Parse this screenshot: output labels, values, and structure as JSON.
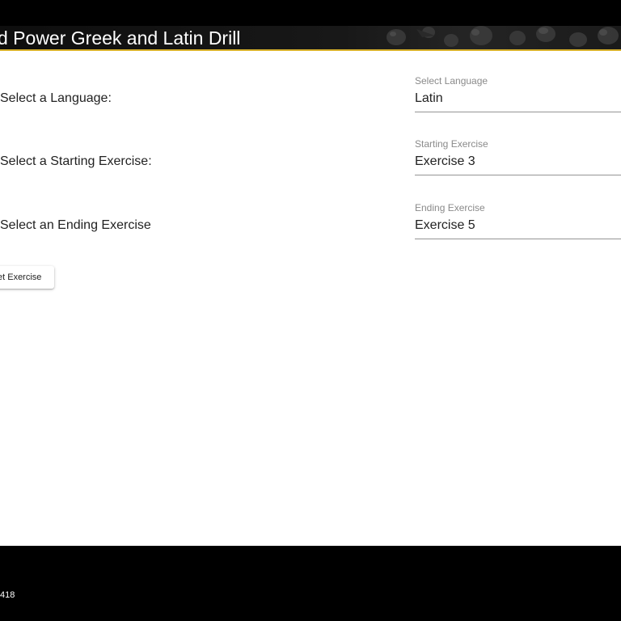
{
  "header": {
    "title": "d Power Greek and Latin Drill",
    "accent_color": "#d8b12b"
  },
  "form": {
    "rows": [
      {
        "label": "Select a Language:",
        "field_label": "Select Language",
        "value": "Latin"
      },
      {
        "label": "Select a Starting Exercise:",
        "field_label": "Starting Exercise",
        "value": "Exercise 3"
      },
      {
        "label": "Select an Ending Exercise",
        "field_label": "Ending Exercise",
        "value": "Exercise 5"
      }
    ],
    "submit_label": "et Exercise"
  },
  "footer": {
    "text": "418"
  }
}
